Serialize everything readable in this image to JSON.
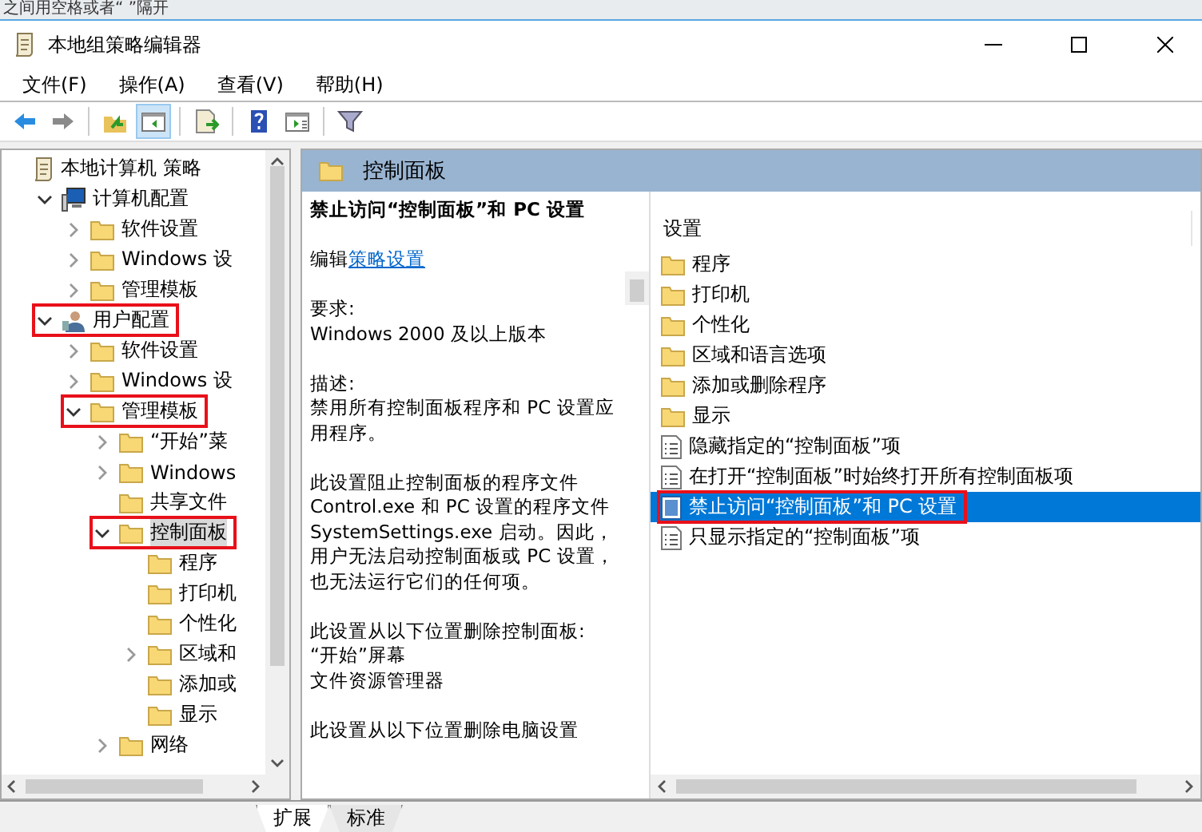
{
  "background_window": {
    "text": "之间用空格或者“ ”隔开"
  },
  "window": {
    "title": "本地组策略编辑器"
  },
  "menu": [
    "文件(F)",
    "操作(A)",
    "查看(V)",
    "帮助(H)"
  ],
  "toolbar": [
    {
      "kind": "back",
      "pressed": false
    },
    {
      "kind": "forward",
      "pressed": false
    },
    {
      "kind": "sep"
    },
    {
      "kind": "up",
      "pressed": false
    },
    {
      "kind": "tree",
      "pressed": true
    },
    {
      "kind": "sep"
    },
    {
      "kind": "export",
      "pressed": false
    },
    {
      "kind": "sep"
    },
    {
      "kind": "help",
      "pressed": false
    },
    {
      "kind": "props",
      "pressed": false
    },
    {
      "kind": "sep"
    },
    {
      "kind": "filter",
      "pressed": false
    }
  ],
  "tree": [
    {
      "label": "本地计算机 策略",
      "kind": "policy",
      "expandable": false,
      "selected": false,
      "highlighted": false,
      "children": [
        {
          "label": "计算机配置",
          "kind": "computer",
          "expandable": true,
          "expanded": true,
          "selected": false,
          "highlighted": false,
          "children": [
            {
              "label": "软件设置",
              "kind": "folder",
              "expandable": true,
              "expanded": false,
              "selected": false,
              "highlighted": false
            },
            {
              "label": "Windows 设",
              "kind": "folder",
              "expandable": true,
              "expanded": false,
              "selected": false,
              "highlighted": false
            },
            {
              "label": "管理模板",
              "kind": "folder",
              "expandable": true,
              "expanded": false,
              "selected": false,
              "highlighted": false
            }
          ]
        },
        {
          "label": "用户配置",
          "kind": "user",
          "expandable": true,
          "expanded": true,
          "selected": false,
          "highlighted": true,
          "children": [
            {
              "label": "软件设置",
              "kind": "folder",
              "expandable": true,
              "expanded": false,
              "selected": false,
              "highlighted": false
            },
            {
              "label": "Windows 设",
              "kind": "folder",
              "expandable": true,
              "expanded": false,
              "selected": false,
              "highlighted": false
            },
            {
              "label": "管理模板",
              "kind": "folder",
              "expandable": true,
              "expanded": true,
              "selected": false,
              "highlighted": true,
              "children": [
                {
                  "label": "“开始”菜",
                  "kind": "folder",
                  "expandable": true,
                  "expanded": false,
                  "selected": false,
                  "highlighted": false
                },
                {
                  "label": "Windows",
                  "kind": "folder",
                  "expandable": true,
                  "expanded": false,
                  "selected": false,
                  "highlighted": false
                },
                {
                  "label": "共享文件",
                  "kind": "folder",
                  "expandable": false,
                  "selected": false,
                  "highlighted": false
                },
                {
                  "label": "控制面板",
                  "kind": "folder",
                  "expandable": true,
                  "expanded": true,
                  "selected": true,
                  "highlighted": true,
                  "children": [
                    {
                      "label": "程序",
                      "kind": "folder",
                      "expandable": false,
                      "selected": false,
                      "highlighted": false
                    },
                    {
                      "label": "打印机",
                      "kind": "folder",
                      "expandable": false,
                      "selected": false,
                      "highlighted": false
                    },
                    {
                      "label": "个性化",
                      "kind": "folder",
                      "expandable": false,
                      "selected": false,
                      "highlighted": false
                    },
                    {
                      "label": "区域和",
                      "kind": "folder",
                      "expandable": true,
                      "expanded": false,
                      "selected": false,
                      "highlighted": false
                    },
                    {
                      "label": "添加或",
                      "kind": "folder",
                      "expandable": false,
                      "selected": false,
                      "highlighted": false
                    },
                    {
                      "label": "显示",
                      "kind": "folder",
                      "expandable": false,
                      "selected": false,
                      "highlighted": false
                    }
                  ]
                },
                {
                  "label": "网络",
                  "kind": "folder",
                  "expandable": true,
                  "expanded": false,
                  "selected": false,
                  "highlighted": false
                }
              ]
            }
          ]
        }
      ]
    }
  ],
  "header": {
    "title": "控制面板"
  },
  "description": {
    "title": "禁止访问“控制面板”和 PC 设置",
    "edit_prefix": "编辑",
    "edit_link": "策略设置",
    "blocks": [
      [
        "要求:",
        "Windows 2000 及以上版本"
      ],
      [
        "描述:",
        "禁用所有控制面板程序和 PC 设置应用程序。"
      ],
      [
        "此设置阻止控制面板的程序文件 Control.exe 和 PC 设置的程序文件 SystemSettings.exe 启动。因此，用户无法启动控制面板或 PC 设置，也无法运行它们的任何项。"
      ],
      [
        "此设置从以下位置删除控制面板:",
        "“开始”屏幕",
        "文件资源管理器"
      ],
      [
        "此设置从以下位置删除电脑设置"
      ]
    ]
  },
  "list": {
    "column": "设置",
    "items": [
      {
        "label": "程序",
        "kind": "folder",
        "selected": false,
        "highlighted": false
      },
      {
        "label": "打印机",
        "kind": "folder",
        "selected": false,
        "highlighted": false
      },
      {
        "label": "个性化",
        "kind": "folder",
        "selected": false,
        "highlighted": false
      },
      {
        "label": "区域和语言选项",
        "kind": "folder",
        "selected": false,
        "highlighted": false
      },
      {
        "label": "添加或删除程序",
        "kind": "folder",
        "selected": false,
        "highlighted": false
      },
      {
        "label": "显示",
        "kind": "folder",
        "selected": false,
        "highlighted": false
      },
      {
        "label": "隐藏指定的“控制面板”项",
        "kind": "setting",
        "selected": false,
        "highlighted": false
      },
      {
        "label": "在打开“控制面板”时始终打开所有控制面板项",
        "kind": "setting",
        "selected": false,
        "highlighted": false
      },
      {
        "label": "禁止访问“控制面板”和 PC 设置",
        "kind": "setting",
        "selected": true,
        "highlighted": true
      },
      {
        "label": "只显示指定的“控制面板”项",
        "kind": "setting",
        "selected": false,
        "highlighted": false
      }
    ]
  },
  "tabs": [
    {
      "label": "扩展",
      "selected": true
    },
    {
      "label": "标准",
      "selected": false
    }
  ]
}
